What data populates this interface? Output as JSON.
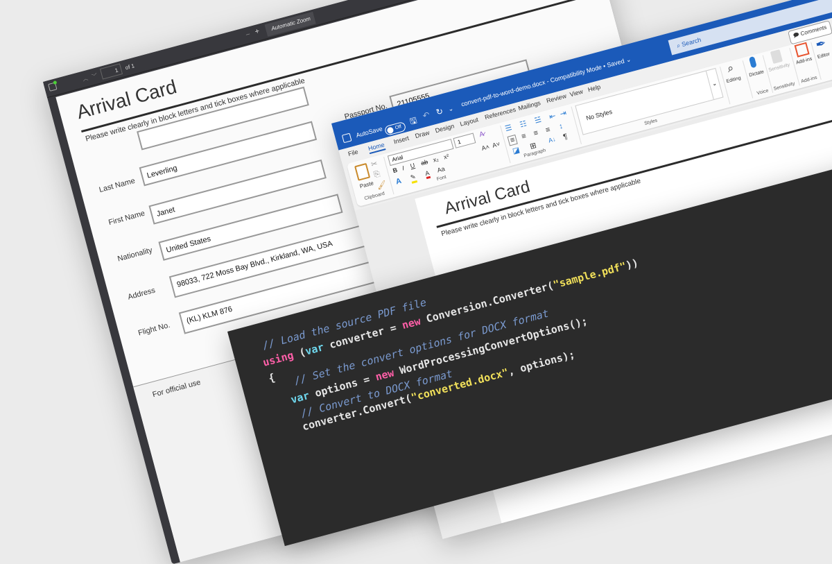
{
  "pdf_viewer": {
    "page_number": "1",
    "page_count": "of 1",
    "zoom": "Automatic Zoom",
    "zoom_out": "−",
    "zoom_in": "+",
    "document": {
      "title": "Arrival Card",
      "subtitle": "Please write clearly in block letters and tick boxes where applicable",
      "passport_label": "Passport No.",
      "passport_value": "21105555",
      "fields": [
        {
          "label": "Last Name",
          "value": "Leverling"
        },
        {
          "label": "First Name",
          "value": "Janet"
        },
        {
          "label": "Nationality",
          "value": "United States"
        },
        {
          "label": "Address",
          "value": "98033, 722 Moss Bay Blvd., Kirkland, WA, USA"
        },
        {
          "label": "Flight No.",
          "value": "(KL) KLM 876"
        }
      ],
      "official_use": "For official use"
    }
  },
  "word": {
    "autosave_label": "AutoSave",
    "autosave_state": "Off",
    "filename": "convert-pdf-to-word-demo.docx  -  Compatibility Mode • Saved ⌄",
    "search_placeholder": "Search",
    "comments": "Comments",
    "tabs": [
      "File",
      "Home",
      "Insert",
      "Draw",
      "Design",
      "Layout",
      "References",
      "Mailings",
      "Review",
      "View",
      "Help"
    ],
    "active_tab": "Home",
    "ribbon": {
      "paste": "Paste",
      "clipboard": "Clipboard",
      "font_name": "Arial",
      "font_size": "1",
      "font": "Font",
      "paragraph": "Paragraph",
      "no_styles": "No Styles",
      "styles": "Styles",
      "editing": "Editing",
      "dictate": "Dictate",
      "voice": "Voice",
      "sensitivity": "Sensitivity",
      "sensitivity_group": "Sensitivity",
      "addins": "Add-ins",
      "addins_group": "Add-ins",
      "editor": "Editor"
    },
    "document": {
      "title": "Arrival Card",
      "subtitle": "Please write clearly in block letters and tick boxes where applicable"
    }
  },
  "code": {
    "lines": [
      [
        {
          "t": "// Load the source PDF file",
          "k": "comment"
        }
      ],
      [
        {
          "t": "using",
          "k": "kw"
        },
        {
          "t": " (",
          "k": "plain"
        },
        {
          "t": "var",
          "k": "var"
        },
        {
          "t": " converter = ",
          "k": "plain"
        },
        {
          "t": "new",
          "k": "kw"
        },
        {
          "t": " Conversion.Converter(",
          "k": "plain"
        },
        {
          "t": "\"sample.pdf\"",
          "k": "str"
        },
        {
          "t": "))",
          "k": "plain"
        }
      ],
      [
        {
          "t": "{",
          "k": "plain"
        }
      ],
      [
        {
          "t": "// Set the convert options for DOCX format",
          "k": "comment"
        }
      ],
      [
        {
          "t": "var",
          "k": "var"
        },
        {
          "t": " options = ",
          "k": "plain"
        },
        {
          "t": "new",
          "k": "kw"
        },
        {
          "t": " WordProcessingConvertOptions();",
          "k": "plain"
        }
      ],
      [
        {
          "t": "// Convert to DOCX format",
          "k": "comment"
        }
      ],
      [
        {
          "t": "converter.Convert(",
          "k": "plain"
        },
        {
          "t": "\"converted.docx\"",
          "k": "str"
        },
        {
          "t": ", options);",
          "k": "plain"
        }
      ]
    ],
    "colors": {
      "comment": "#7b9bd1",
      "keyword": "#ff5fa8",
      "var": "#6fd8ee",
      "string": "#f1e05a",
      "background": "#2b2b2b"
    }
  }
}
